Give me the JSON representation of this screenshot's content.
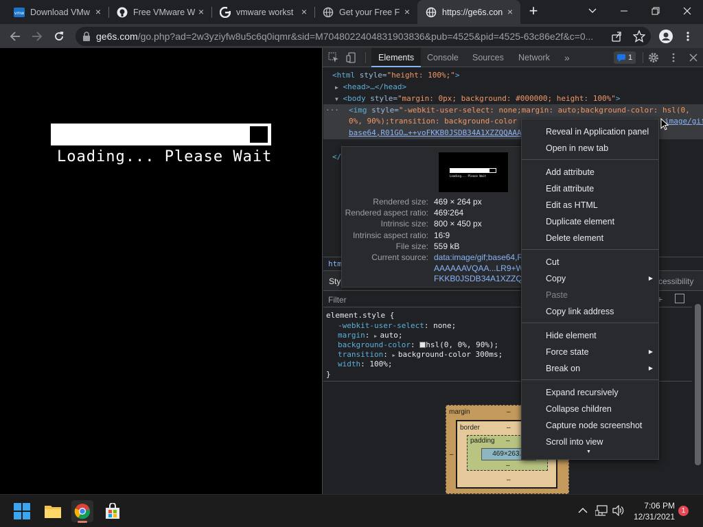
{
  "tabs": [
    {
      "title": "Download VMw",
      "icon": "vmware-icon",
      "close": "×"
    },
    {
      "title": "Free VMware W",
      "icon": "github-icon",
      "close": "×"
    },
    {
      "title": "vmware workst",
      "icon": "google-icon",
      "close": "×"
    },
    {
      "title": "Get your Free F",
      "icon": "globe-icon",
      "close": "×"
    },
    {
      "title": "https://ge6s.con",
      "icon": "globe-icon",
      "close": "×"
    }
  ],
  "new_tab": "+",
  "address": {
    "host": "ge6s.com",
    "path": "/go.php?ad=2w3yziyfw8u5c6q0iqmr&sid=M7048022404831903836&pub=4525&pid=4525-63c86e2f&c=0..."
  },
  "page": {
    "loading_text": "Loading... Please Wait"
  },
  "devtools": {
    "tabs": [
      "Elements",
      "Console",
      "Sources",
      "Network"
    ],
    "more": "»",
    "issues_count": "1",
    "dom": {
      "l1_tag": "<html",
      "l1_attr": " style=",
      "l1_val": "\"height: 100%;\"",
      "l1_end": ">",
      "l2": "<head>…</head>",
      "l3_tag": "<body",
      "l3_attr": " style=",
      "l3_val": "\"margin: 0px; background: #000000; height: 100%\"",
      "l3_end": ">",
      "l4_tag": "<img",
      "l4_attr": " style=",
      "l4_val": "\"-webkit-user-select: none;margin: auto;background-color: hsl(0,",
      "l5_val": "0%, 90%);transition: background-color",
      "l5_link": "image/gif;",
      "l6_link": "base64,R01GO…++voFKKB0JSDB34A1XZZQQAAA",
      "l8": "</"
    },
    "breadcrumb": "htm",
    "styles_tab": "Styl",
    "accessibility": "cessibility",
    "filter_placeholder": "Filter",
    "css": {
      "selector": "element.style {",
      "p1": "-webkit-user-select",
      "v1": "none;",
      "p2": "margin",
      "v2": "auto;",
      "p3": "background-color",
      "v3": "hsl(0, 0%, 90%);",
      "p4": "transition",
      "v4": "background-color 300ms;",
      "p5": "width",
      "v5": "100%;",
      "close": "}"
    },
    "boxmodel": {
      "margin": "margin",
      "border": "border",
      "padding": "padding",
      "dash": "–",
      "content": "469×263.8"
    }
  },
  "tooltip": {
    "thumb_text": "Loading... Please Wait",
    "rows": [
      {
        "k": "Rendered size:",
        "v": "469 × 264 px"
      },
      {
        "k": "Rendered aspect ratio:",
        "v": "469∶264"
      },
      {
        "k": "Intrinsic size:",
        "v": "800 × 450 px"
      },
      {
        "k": "Intrinsic aspect ratio:",
        "v": "16∶9"
      },
      {
        "k": "File size:",
        "v": "559 kB"
      },
      {
        "k": "Current source:",
        "v": "data:image/gif;base64,R"
      }
    ],
    "src2": "AAAAAAVQAA...LR9+WH",
    "src3": "FKKB0JSDB34A1XZZQQA"
  },
  "context_menu": {
    "items": [
      {
        "label": "Reveal in Application panel"
      },
      {
        "label": "Open in new tab"
      },
      {
        "label": "Add attribute"
      },
      {
        "label": "Edit attribute"
      },
      {
        "label": "Edit as HTML"
      },
      {
        "label": "Duplicate element"
      },
      {
        "label": "Delete element"
      },
      {
        "label": "Cut"
      },
      {
        "label": "Copy"
      },
      {
        "label": "Paste"
      },
      {
        "label": "Copy link address"
      },
      {
        "label": "Hide element"
      },
      {
        "label": "Force state"
      },
      {
        "label": "Break on"
      },
      {
        "label": "Expand recursively"
      },
      {
        "label": "Collapse children"
      },
      {
        "label": "Capture node screenshot"
      },
      {
        "label": "Scroll into view"
      }
    ],
    "submenu_arrow": "▶",
    "scroll_down": "▼"
  },
  "taskbar": {
    "time": "7:06 PM",
    "date": "12/31/2021",
    "notifications": "1"
  }
}
